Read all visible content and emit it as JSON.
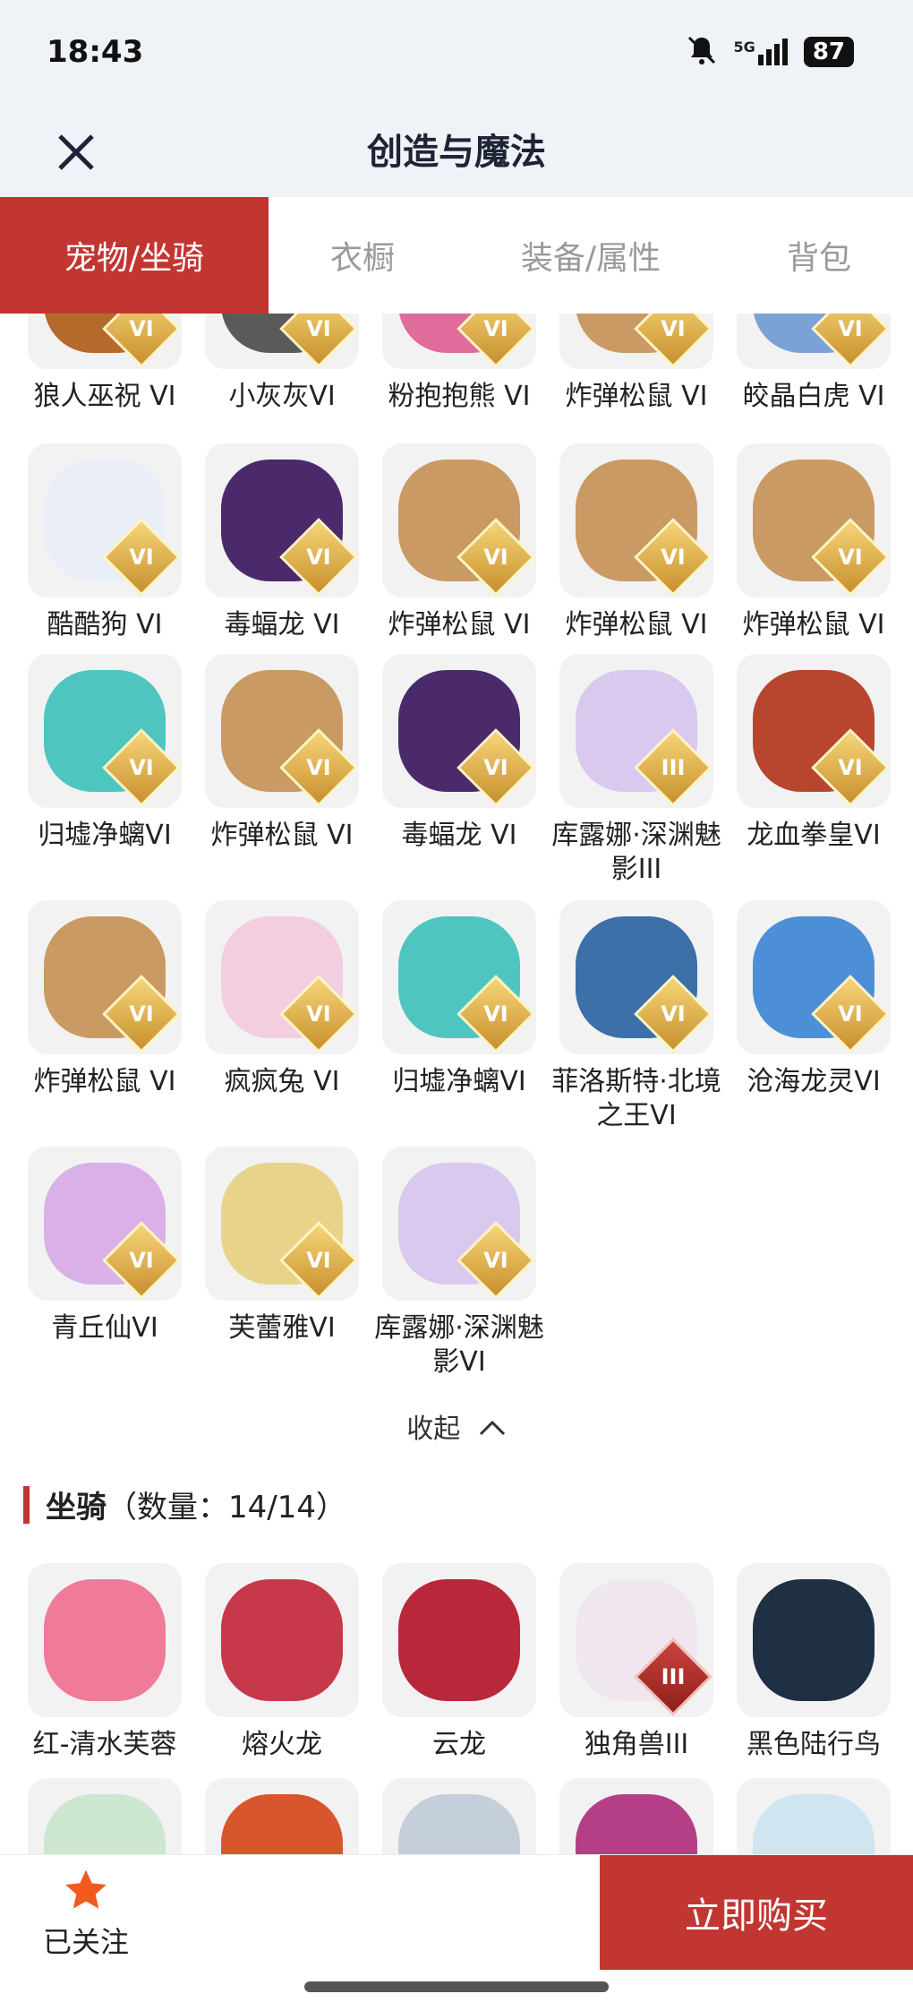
{
  "status": {
    "time": "18:43",
    "network": "5G",
    "battery": "87"
  },
  "header": {
    "title": "创造与魔法"
  },
  "tabs": [
    {
      "label": "宠物/坐骑"
    },
    {
      "label": "衣橱"
    },
    {
      "label": "装备/属性"
    },
    {
      "label": "背包"
    }
  ],
  "pets": [
    {
      "name": "狼人巫祝 VI",
      "badge": "VI",
      "color": "#b46a2a"
    },
    {
      "name": "小灰灰VI",
      "badge": "VI",
      "color": "#5a5a5a"
    },
    {
      "name": "粉抱抱熊 VI",
      "badge": "VI",
      "color": "#e06c9c"
    },
    {
      "name": "炸弹松鼠 VI",
      "badge": "VI",
      "color": "#c99a63"
    },
    {
      "name": "皎晶白虎 VI",
      "badge": "VI",
      "color": "#7aa2d6"
    },
    {
      "name": "酷酷狗 VI",
      "badge": "VI",
      "color": "#e9eef7"
    },
    {
      "name": "毒蝠龙 VI",
      "badge": "VI",
      "color": "#4b2a6b"
    },
    {
      "name": "炸弹松鼠 VI",
      "badge": "VI",
      "color": "#c99a63"
    },
    {
      "name": "炸弹松鼠 VI",
      "badge": "VI",
      "color": "#c99a63"
    },
    {
      "name": "炸弹松鼠 VI",
      "badge": "VI",
      "color": "#c99a63"
    },
    {
      "name": "归墟净螭VI",
      "badge": "VI",
      "color": "#4fc5c0"
    },
    {
      "name": "炸弹松鼠 VI",
      "badge": "VI",
      "color": "#c99a63"
    },
    {
      "name": "毒蝠龙 VI",
      "badge": "VI",
      "color": "#4b2a6b"
    },
    {
      "name": "库露娜·深渊魅影III",
      "badge": "III",
      "color": "#d9c9ee"
    },
    {
      "name": "龙血拳皇VI",
      "badge": "VI",
      "color": "#b8452e"
    },
    {
      "name": "炸弹松鼠 VI",
      "badge": "VI",
      "color": "#c99a63"
    },
    {
      "name": "疯疯兔 VI",
      "badge": "VI",
      "color": "#f3cde0"
    },
    {
      "name": "归墟净螭VI",
      "badge": "VI",
      "color": "#4fc5c0"
    },
    {
      "name": "菲洛斯特·北境之王VI",
      "badge": "VI",
      "color": "#3d6fa8"
    },
    {
      "name": "沧海龙灵VI",
      "badge": "VI",
      "color": "#4d8fd6"
    },
    {
      "name": "青丘仙VI",
      "badge": "VI",
      "color": "#d9b0e8"
    },
    {
      "name": "芙蕾雅VI",
      "badge": "VI",
      "color": "#e8d38a"
    },
    {
      "name": "库露娜·深渊魅影VI",
      "badge": "VI",
      "color": "#d9c9ee"
    }
  ],
  "collapse_label": "收起",
  "mounts_section": {
    "title": "坐骑",
    "count": "（数量：14/14）"
  },
  "mounts": [
    {
      "name": "红-清水芙蓉",
      "badge": "",
      "color": "#f07a9a"
    },
    {
      "name": "熔火龙",
      "badge": "",
      "color": "#c7384a"
    },
    {
      "name": "云龙",
      "badge": "",
      "color": "#b8283a"
    },
    {
      "name": "独角兽III",
      "badge": "III",
      "color": "#f0e6f0"
    },
    {
      "name": "黑色陆行鸟",
      "badge": "",
      "color": "#1f2f44"
    },
    {
      "name": "",
      "badge": "",
      "color": "#cde6cf"
    },
    {
      "name": "",
      "badge": "",
      "color": "#d8562e"
    },
    {
      "name": "",
      "badge": "",
      "color": "#c5cfdb"
    },
    {
      "name": "",
      "badge": "",
      "color": "#b43f86"
    },
    {
      "name": "",
      "badge": "",
      "color": "#cfe5ef"
    }
  ],
  "footer": {
    "follow_label": "已关注",
    "buy_label": "立即购买"
  },
  "colors": {
    "accent": "#c23632",
    "star": "#f05a1e"
  }
}
